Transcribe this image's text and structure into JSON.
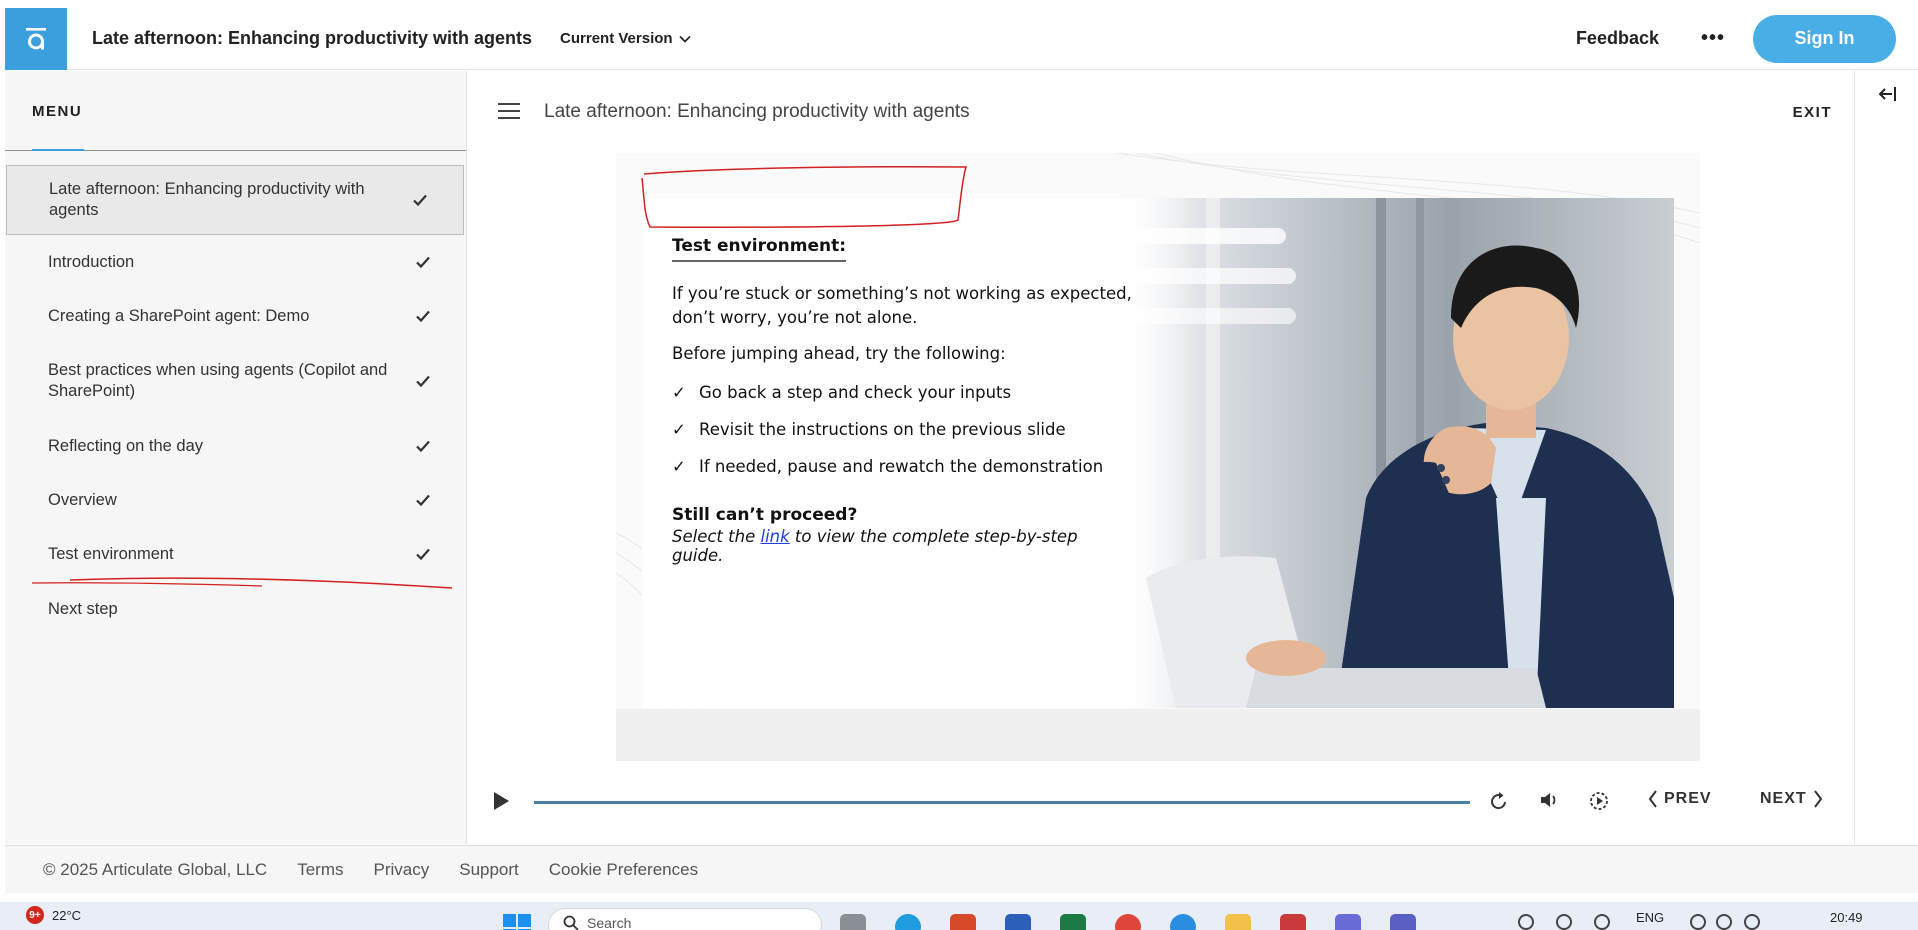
{
  "header": {
    "course_title": "Late afternoon: Enhancing productivity with agents",
    "version_label": "Current Version",
    "feedback_label": "Feedback",
    "more_label": "•••",
    "signin_label": "Sign In"
  },
  "sidebar": {
    "menu_label": "MENU",
    "items": [
      {
        "label": "Late afternoon: Enhancing productivity with agents",
        "completed": true,
        "active": true
      },
      {
        "label": "Introduction",
        "completed": true
      },
      {
        "label": "Creating a SharePoint agent: Demo",
        "completed": true
      },
      {
        "label": "Best practices when using agents (Copilot and SharePoint)",
        "completed": true
      },
      {
        "label": "Reflecting on the day",
        "completed": true
      },
      {
        "label": "Overview",
        "completed": true
      },
      {
        "label": "Test environment",
        "completed": true
      },
      {
        "label": "Next step",
        "completed": false
      }
    ]
  },
  "main": {
    "lesson_title": "Late afternoon: Enhancing productivity with agents",
    "exit_label": "EXIT"
  },
  "slide": {
    "heading": "Test environment:",
    "intro": "If you’re stuck or something’s not working as expected, don’t worry, you’re not alone.",
    "before": "Before jumping ahead, try the following:",
    "tips": [
      "Go back a step and check your inputs",
      "Revisit the instructions on the previous slide",
      "If needed, pause and rewatch the demonstration"
    ],
    "question": "Still can’t proceed?",
    "guide_prefix": "Select the ",
    "guide_link": "link",
    "guide_suffix": " to view the complete step-by-step guide."
  },
  "player": {
    "prev_label": "PREV",
    "next_label": "NEXT",
    "progress": 1.0
  },
  "footer": {
    "copyright": "© 2025 Articulate Global, LLC",
    "links": [
      "Terms",
      "Privacy",
      "Support",
      "Cookie Preferences"
    ]
  },
  "taskbar": {
    "weather_badge": "9+",
    "temperature": "22°C",
    "search_placeholder": "Search",
    "language": "ENG",
    "time": "20:49"
  },
  "colors": {
    "accent": "#3a9fdc",
    "signin": "#4aaee6",
    "progress": "#4a7fa8",
    "annotation": "#d42020"
  }
}
